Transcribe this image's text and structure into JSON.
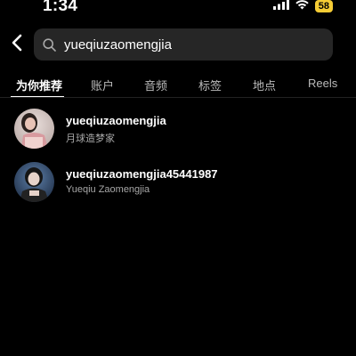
{
  "status_bar": {
    "time": "1:34",
    "battery": "58",
    "icons": [
      "cellular-signal-icon",
      "wifi-icon",
      "battery-icon"
    ]
  },
  "search": {
    "query": "yueqiuzaomengjia",
    "icons": [
      "back-chevron-icon",
      "search-icon"
    ]
  },
  "tabs": [
    {
      "label": "为你推荐",
      "active": true
    },
    {
      "label": "账户",
      "active": false
    },
    {
      "label": "音频",
      "active": false
    },
    {
      "label": "标签",
      "active": false
    },
    {
      "label": "地点",
      "active": false
    },
    {
      "label": "Reels",
      "active": false
    }
  ],
  "results": [
    {
      "username": "yueqiuzaomengjia",
      "full_name": "月球造梦家"
    },
    {
      "username": "yueqiuzaomengjia45441987",
      "full_name": "Yueqiu Zaomengjia"
    }
  ],
  "colors": {
    "background": "#000000",
    "search_box": "#262626",
    "secondary_text": "#a8a8a8",
    "battery_fill": "#f5cc35"
  }
}
